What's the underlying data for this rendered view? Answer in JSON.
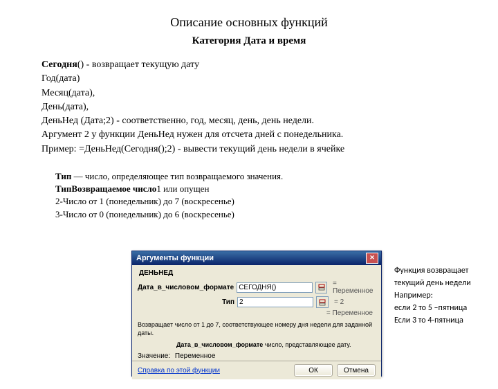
{
  "title": "Описание основных функций",
  "subtitle": "Категория Дата и время",
  "desc": {
    "line1_bold": "Сегодня",
    "line1_rest": "() - возвращает текущую дату",
    "line2": "Год(дата)",
    "line3": " Месяц(дата),",
    "line4": "День(дата),",
    "line5": "ДеньНед (Дата;2) - соответственно, год, месяц, день, день недели.",
    "line6": "Аргумент 2 у функции ДеньНед нужен для отсчета дней с понедельника.",
    "line7": "Пример: =ДеньНед(Сегодня();2) - вывести текущий день недели в ячейке"
  },
  "typeblock": {
    "l1a": "Тип",
    "l1b": "   — число, определяющее тип возвращаемого значения.",
    "l2a": "ТипВозвращаемое число",
    "l2b": "1 или опущен",
    "l3": "2-Число от 1 (понедельник) до 7 (воскресенье)",
    "l4": "3-Число от 0 (понедельник) до 6 (воскресенье)"
  },
  "dialog": {
    "title": "Аргументы функции",
    "fn": "ДЕНЬНЕД",
    "arg1_label": "Дата_в_числовом_формате",
    "arg1_value": "СЕГОДНЯ()",
    "arg1_eval": "= Переменное",
    "arg2_label": "Тип",
    "arg2_value": "2",
    "arg2_eval": "= 2",
    "result_eval": "= Переменное",
    "hint1": "Возвращает число от 1 до 7, соответствующее номеру дня недели для заданной даты.",
    "hint2_label": "Дата_в_числовом_формате",
    "hint2_rest": " число, представляющее дату.",
    "result_label": "Значение:",
    "result_value": "Переменное",
    "help": "Справка по этой функции",
    "ok": "ОК",
    "cancel": "Отмена"
  },
  "sidenote": {
    "l1": "Функция возвращает текущий день недели",
    "l2": "Например:",
    "l3": "если 2 то 5 –пятница",
    "l4": "Если 3 то 4-пятница"
  }
}
